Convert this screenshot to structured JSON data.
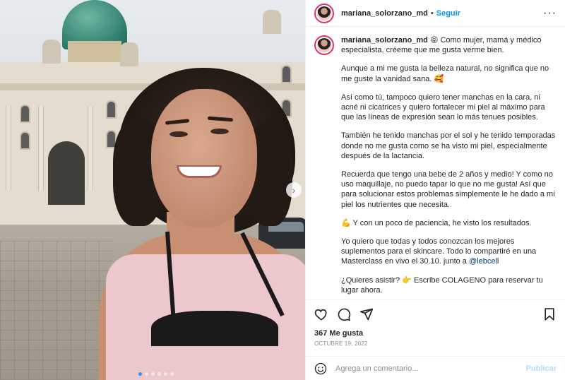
{
  "post": {
    "username": "mariana_solorzano_md",
    "separator": "•",
    "follow_label": "Seguir",
    "more_label": "···",
    "photo_alt": "Selfie frente a palacio",
    "carousel_next": "›"
  },
  "caption": {
    "username": "mariana_solorzano_md",
    "paragraphs": [
      "😝 Como mujer, mamá y médico especialista, créeme que me gusta verme bien.",
      "Aunque a mi me gusta la belleza natural, no significa que no me guste la vanidad sana. 🥰",
      "Así como tú, tampoco quiero tener manchas en la cara, ni acné ni cicatrices y quiero fortalecer mi piel al máximo para que las líneas de expresión sean lo más tenues posibles.",
      "También he tenido manchas por el sol y he tenido temporadas donde no me gusta como se ha visto mi piel, especialmente después de la lactancia.",
      "Recuerda que tengo una bebe de 2 años y medio! Y como no uso maquillaje, no puedo tapar lo que no me gusta! Así que para solucionar estos problemas simplemente le he dado a mi piel los nutrientes que necesita.",
      "💪 Y con un poco de paciencia, he visto los resultados.",
      "Yo quiero que todas y todos conozcan los mejores suplementos para el skincare. Todo lo compartiré en una Masterclass en vivo el 30.10. junto a",
      "¿Quieres asistir? 👉 Escribe COLAGENO para reservar tu lugar ahora."
    ],
    "mention": "@lebcell"
  },
  "stats": {
    "likes": "367 Me gusta",
    "date": "OCTUBRE 19, 2022"
  },
  "comment": {
    "placeholder": "Agrega un comentario...",
    "publish_label": "Publicar"
  },
  "icons": {
    "like": "heart-icon",
    "comment": "comment-icon",
    "share": "share-icon",
    "save": "bookmark-icon",
    "emoji": "emoji-icon"
  },
  "colors": {
    "accent": "#0095f6",
    "publish_disabled": "#b3dbff",
    "story_ring": "#e1306c"
  }
}
